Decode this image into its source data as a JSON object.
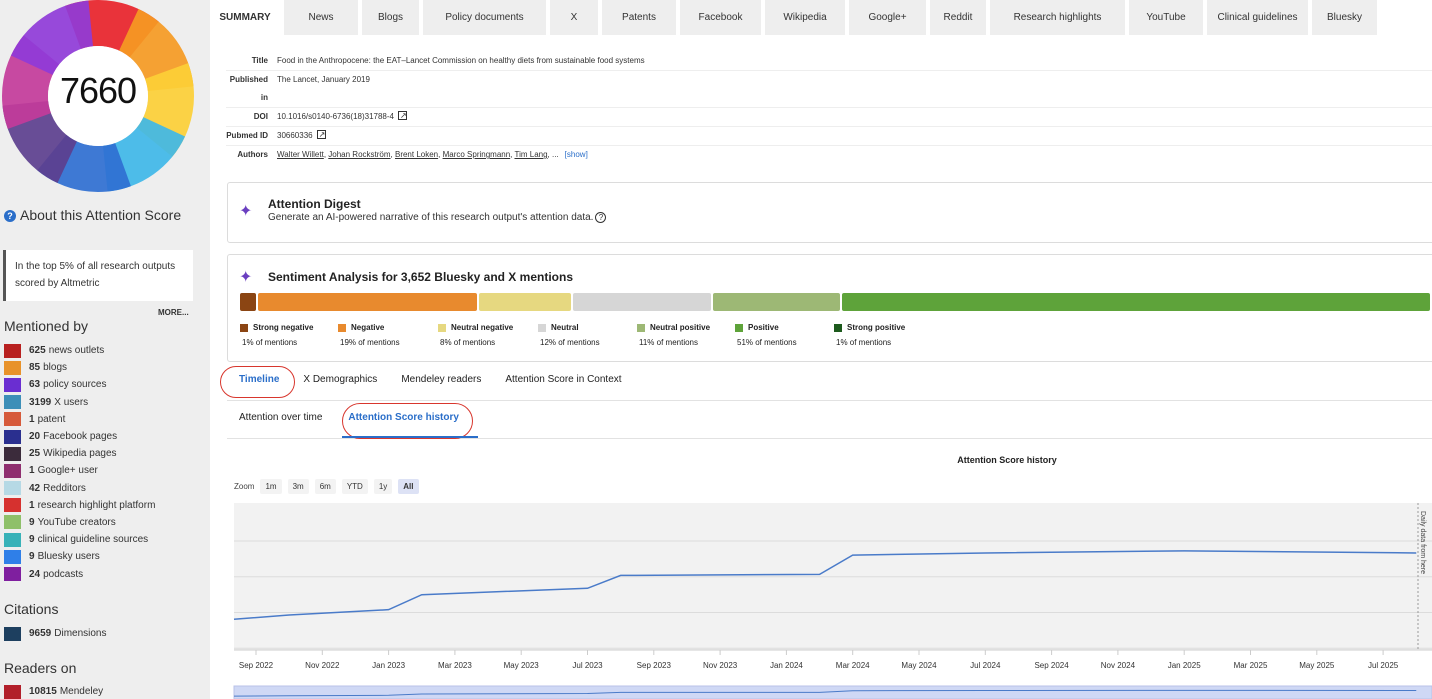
{
  "score": "7660",
  "donut_colors": [
    "#e8232a",
    "#f59a23",
    "#fccf36",
    "#3fb7e8",
    "#2f6fd1",
    "#5c3f8e",
    "#c33b9a",
    "#8f3bd8"
  ],
  "sidebar": {
    "about_title": "About this Attention Score",
    "summary_text": "In the top 5% of all research outputs scored by Altmetric",
    "more": "MORE...",
    "mentioned_by_title": "Mentioned by",
    "mentioned_by": [
      {
        "count": "625",
        "label": "news outlets",
        "color": "#b8201f"
      },
      {
        "count": "85",
        "label": "blogs",
        "color": "#e8922a"
      },
      {
        "count": "63",
        "label": "policy sources",
        "color": "#6a2ed1"
      },
      {
        "count": "3199",
        "label": "X users",
        "color": "#3d8fb8"
      },
      {
        "count": "1",
        "label": "patent",
        "color": "#d65a3a"
      },
      {
        "count": "20",
        "label": "Facebook pages",
        "color": "#2a2f8f"
      },
      {
        "count": "25",
        "label": "Wikipedia pages",
        "color": "#3b2b3b"
      },
      {
        "count": "1",
        "label": "Google+ user",
        "color": "#8f2f6f"
      },
      {
        "count": "42",
        "label": "Redditors",
        "color": "#b6d9e5"
      },
      {
        "count": "1",
        "label": "research highlight platform",
        "color": "#d6312f"
      },
      {
        "count": "9",
        "label": "YouTube creators",
        "color": "#8fc06a"
      },
      {
        "count": "9",
        "label": "clinical guideline sources",
        "color": "#38b2b8"
      },
      {
        "count": "9",
        "label": "Bluesky users",
        "color": "#2f7fe8"
      },
      {
        "count": "24",
        "label": "podcasts",
        "color": "#7f1f9f"
      }
    ],
    "citations_title": "Citations",
    "citations": [
      {
        "count": "9659",
        "label": "Dimensions",
        "color": "#1d3f5f"
      }
    ],
    "readers_title": "Readers on",
    "readers": [
      {
        "count": "10815",
        "label": "Mendeley",
        "color": "#b21f2a"
      }
    ]
  },
  "tabs": [
    "SUMMARY",
    "News",
    "Blogs",
    "Policy documents",
    "X",
    "Patents",
    "Facebook",
    "Wikipedia",
    "Google+",
    "Reddit",
    "Research highlights",
    "YouTube",
    "Clinical guidelines",
    "Bluesky"
  ],
  "meta": {
    "title_label": "Title",
    "title": "Food in the Anthropocene: the EAT–Lancet Commission on healthy diets from sustainable food systems",
    "published_label": "Published in",
    "published": "The Lancet, January 2019",
    "doi_label": "DOI",
    "doi": "10.1016/s0140-6736(18)31788-4",
    "pubmed_label": "Pubmed ID",
    "pubmed": "30660336",
    "authors_label": "Authors",
    "authors": [
      "Walter Willett",
      "Johan Rockström",
      "Brent Loken",
      "Marco Springmann",
      "Tim Lang"
    ],
    "authors_ellipsis": "...",
    "show": "[show]"
  },
  "digest": {
    "title": "Attention Digest",
    "subtitle": "Generate an AI-powered narrative of this research output's attention data."
  },
  "sentiment": {
    "title": "Sentiment Analysis for 3,652 Bluesky and X mentions",
    "segments": [
      {
        "label": "Strong negative",
        "pct": "1% of mentions",
        "value": 1,
        "color": "#8b4513"
      },
      {
        "label": "Negative",
        "pct": "19% of mentions",
        "value": 19,
        "color": "#e88a2e"
      },
      {
        "label": "Neutral negative",
        "pct": "8% of mentions",
        "value": 8,
        "color": "#e6d880"
      },
      {
        "label": "Neutral",
        "pct": "12% of mentions",
        "value": 12,
        "color": "#d6d6d6"
      },
      {
        "label": "Neutral positive",
        "pct": "11% of mentions",
        "value": 11,
        "color": "#9db875"
      },
      {
        "label": "Positive",
        "pct": "51% of mentions",
        "value": 51,
        "color": "#5ea33a"
      },
      {
        "label": "Strong positive",
        "pct": "1% of mentions",
        "value": 1,
        "color": "#1d5a1d"
      }
    ]
  },
  "subtabs": [
    "Timeline",
    "X Demographics",
    "Mendeley readers",
    "Attention Score in Context"
  ],
  "subtabs2": [
    "Attention over time",
    "Attention Score history"
  ],
  "zoom": {
    "label": "Zoom",
    "buttons": [
      "1m",
      "3m",
      "6m",
      "YTD",
      "1y",
      "All"
    ],
    "active": "All"
  },
  "chart_data": {
    "type": "line",
    "title": "Attention Score history",
    "x_ticks": [
      "Sep 2022",
      "Nov 2022",
      "Jan 2023",
      "Mar 2023",
      "May 2023",
      "Jul 2023",
      "Sep 2023",
      "Nov 2023",
      "Jan 2024",
      "Mar 2024",
      "May 2024",
      "Jul 2024",
      "Sep 2024",
      "Nov 2024",
      "Jan 2025",
      "Mar 2025",
      "May 2025",
      "Jul 2025"
    ],
    "annotation": "Daily data from here",
    "series": [
      {
        "values": [
          [
            "Jul 2022",
            0.1
          ],
          [
            "Oct 2022",
            0.14
          ],
          [
            "Jan 2023",
            0.19
          ],
          [
            "Feb 2023",
            0.33
          ],
          [
            "Jul 2023",
            0.39
          ],
          [
            "Aug 2023",
            0.51
          ],
          [
            "Feb 2024",
            0.52
          ],
          [
            "Mar 2024",
            0.7
          ],
          [
            "Jul 2024",
            0.72
          ],
          [
            "Jan 2025",
            0.74
          ],
          [
            "Aug 2025",
            0.72
          ]
        ]
      }
    ],
    "y_relative": true,
    "grid": true
  }
}
